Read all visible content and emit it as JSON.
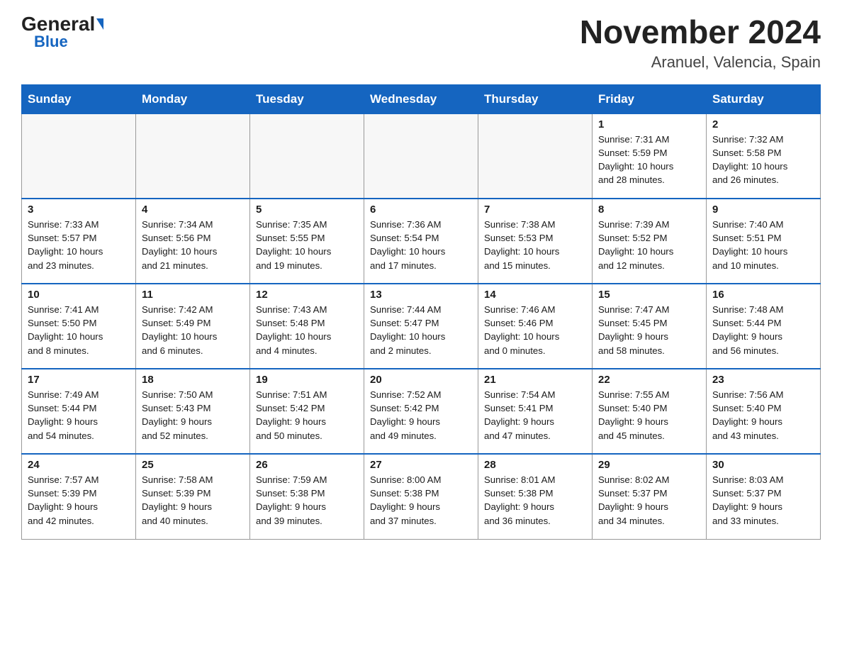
{
  "header": {
    "logo_general": "General",
    "logo_blue": "Blue",
    "month_year": "November 2024",
    "location": "Aranuel, Valencia, Spain"
  },
  "weekdays": [
    "Sunday",
    "Monday",
    "Tuesday",
    "Wednesday",
    "Thursday",
    "Friday",
    "Saturday"
  ],
  "weeks": [
    [
      {
        "day": "",
        "info": ""
      },
      {
        "day": "",
        "info": ""
      },
      {
        "day": "",
        "info": ""
      },
      {
        "day": "",
        "info": ""
      },
      {
        "day": "",
        "info": ""
      },
      {
        "day": "1",
        "info": "Sunrise: 7:31 AM\nSunset: 5:59 PM\nDaylight: 10 hours\nand 28 minutes."
      },
      {
        "day": "2",
        "info": "Sunrise: 7:32 AM\nSunset: 5:58 PM\nDaylight: 10 hours\nand 26 minutes."
      }
    ],
    [
      {
        "day": "3",
        "info": "Sunrise: 7:33 AM\nSunset: 5:57 PM\nDaylight: 10 hours\nand 23 minutes."
      },
      {
        "day": "4",
        "info": "Sunrise: 7:34 AM\nSunset: 5:56 PM\nDaylight: 10 hours\nand 21 minutes."
      },
      {
        "day": "5",
        "info": "Sunrise: 7:35 AM\nSunset: 5:55 PM\nDaylight: 10 hours\nand 19 minutes."
      },
      {
        "day": "6",
        "info": "Sunrise: 7:36 AM\nSunset: 5:54 PM\nDaylight: 10 hours\nand 17 minutes."
      },
      {
        "day": "7",
        "info": "Sunrise: 7:38 AM\nSunset: 5:53 PM\nDaylight: 10 hours\nand 15 minutes."
      },
      {
        "day": "8",
        "info": "Sunrise: 7:39 AM\nSunset: 5:52 PM\nDaylight: 10 hours\nand 12 minutes."
      },
      {
        "day": "9",
        "info": "Sunrise: 7:40 AM\nSunset: 5:51 PM\nDaylight: 10 hours\nand 10 minutes."
      }
    ],
    [
      {
        "day": "10",
        "info": "Sunrise: 7:41 AM\nSunset: 5:50 PM\nDaylight: 10 hours\nand 8 minutes."
      },
      {
        "day": "11",
        "info": "Sunrise: 7:42 AM\nSunset: 5:49 PM\nDaylight: 10 hours\nand 6 minutes."
      },
      {
        "day": "12",
        "info": "Sunrise: 7:43 AM\nSunset: 5:48 PM\nDaylight: 10 hours\nand 4 minutes."
      },
      {
        "day": "13",
        "info": "Sunrise: 7:44 AM\nSunset: 5:47 PM\nDaylight: 10 hours\nand 2 minutes."
      },
      {
        "day": "14",
        "info": "Sunrise: 7:46 AM\nSunset: 5:46 PM\nDaylight: 10 hours\nand 0 minutes."
      },
      {
        "day": "15",
        "info": "Sunrise: 7:47 AM\nSunset: 5:45 PM\nDaylight: 9 hours\nand 58 minutes."
      },
      {
        "day": "16",
        "info": "Sunrise: 7:48 AM\nSunset: 5:44 PM\nDaylight: 9 hours\nand 56 minutes."
      }
    ],
    [
      {
        "day": "17",
        "info": "Sunrise: 7:49 AM\nSunset: 5:44 PM\nDaylight: 9 hours\nand 54 minutes."
      },
      {
        "day": "18",
        "info": "Sunrise: 7:50 AM\nSunset: 5:43 PM\nDaylight: 9 hours\nand 52 minutes."
      },
      {
        "day": "19",
        "info": "Sunrise: 7:51 AM\nSunset: 5:42 PM\nDaylight: 9 hours\nand 50 minutes."
      },
      {
        "day": "20",
        "info": "Sunrise: 7:52 AM\nSunset: 5:42 PM\nDaylight: 9 hours\nand 49 minutes."
      },
      {
        "day": "21",
        "info": "Sunrise: 7:54 AM\nSunset: 5:41 PM\nDaylight: 9 hours\nand 47 minutes."
      },
      {
        "day": "22",
        "info": "Sunrise: 7:55 AM\nSunset: 5:40 PM\nDaylight: 9 hours\nand 45 minutes."
      },
      {
        "day": "23",
        "info": "Sunrise: 7:56 AM\nSunset: 5:40 PM\nDaylight: 9 hours\nand 43 minutes."
      }
    ],
    [
      {
        "day": "24",
        "info": "Sunrise: 7:57 AM\nSunset: 5:39 PM\nDaylight: 9 hours\nand 42 minutes."
      },
      {
        "day": "25",
        "info": "Sunrise: 7:58 AM\nSunset: 5:39 PM\nDaylight: 9 hours\nand 40 minutes."
      },
      {
        "day": "26",
        "info": "Sunrise: 7:59 AM\nSunset: 5:38 PM\nDaylight: 9 hours\nand 39 minutes."
      },
      {
        "day": "27",
        "info": "Sunrise: 8:00 AM\nSunset: 5:38 PM\nDaylight: 9 hours\nand 37 minutes."
      },
      {
        "day": "28",
        "info": "Sunrise: 8:01 AM\nSunset: 5:38 PM\nDaylight: 9 hours\nand 36 minutes."
      },
      {
        "day": "29",
        "info": "Sunrise: 8:02 AM\nSunset: 5:37 PM\nDaylight: 9 hours\nand 34 minutes."
      },
      {
        "day": "30",
        "info": "Sunrise: 8:03 AM\nSunset: 5:37 PM\nDaylight: 9 hours\nand 33 minutes."
      }
    ]
  ]
}
